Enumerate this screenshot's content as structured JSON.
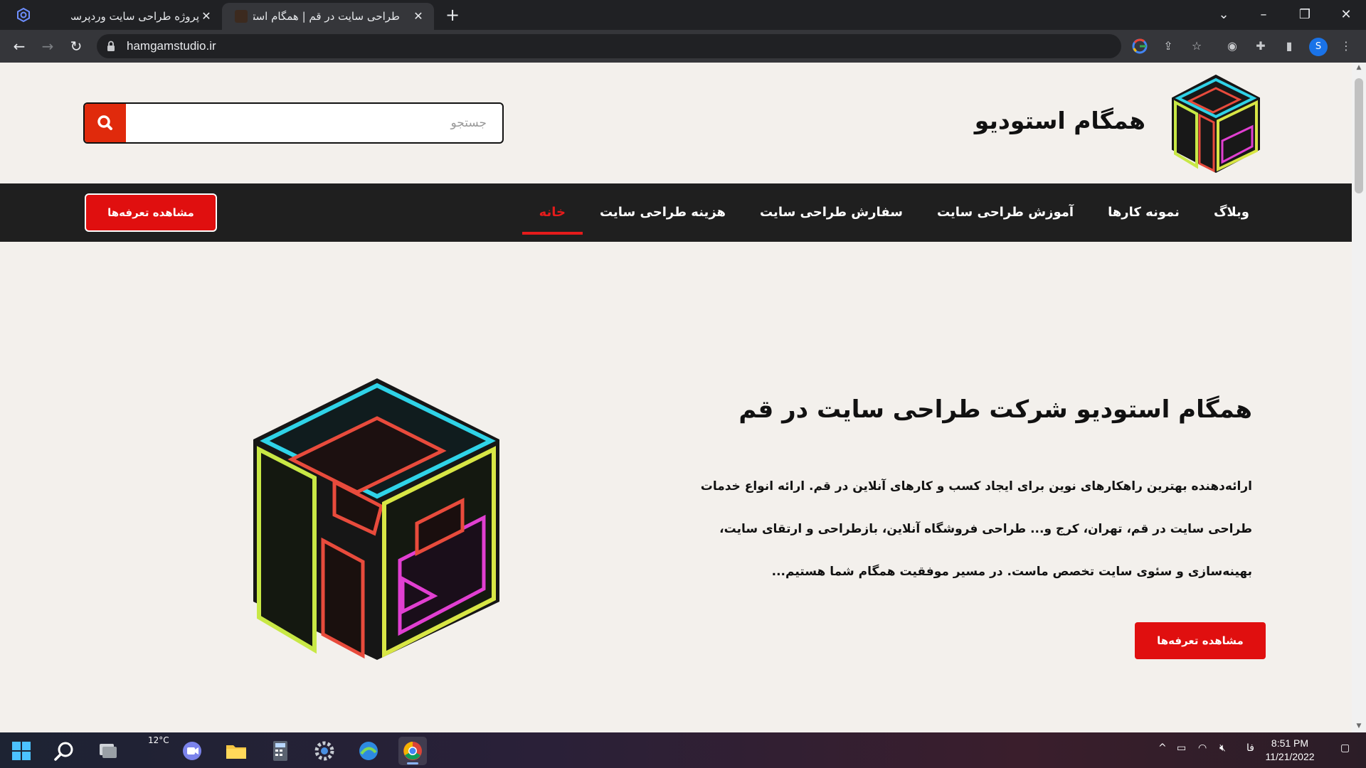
{
  "browser": {
    "tabs": [
      {
        "title": "پروژه طراحی سایت وردپرسی",
        "active": false
      },
      {
        "title": "طراحی سایت در قم | همگام استودیو",
        "active": true
      }
    ],
    "url": "hamgamstudio.ir",
    "profile_initial": "S"
  },
  "site": {
    "name": "همگام استودیو",
    "search_placeholder": "جستجو",
    "nav": [
      {
        "label": "خانه",
        "active": true
      },
      {
        "label": "هزینه طراحی سایت",
        "active": false
      },
      {
        "label": "سفارش طراحی سایت",
        "active": false
      },
      {
        "label": "آموزش طراحی سایت",
        "active": false
      },
      {
        "label": "نمونه کارها",
        "active": false
      },
      {
        "label": "وبلاگ",
        "active": false
      }
    ],
    "nav_cta": "مشاهده تعرفه‌ها",
    "accent": "#e00f0f"
  },
  "hero": {
    "title": "همگام استودیو شرکت طراحی سایت در قم",
    "text": "ارائه‌دهنده بهترین راهکارهای نوین برای ایجاد کسب و کارهای آنلاین در قم. ارائه انواع خدمات طراحی سایت در قم، تهران، کرج و... طراحی فروشگاه آنلاین، بازطراحی و ارتقای سایت، بهینه‌سازی و سئوی سایت تخصص ماست. در مسیر موفقیت همگام شما هستیم...",
    "cta": "مشاهده تعرفه‌ها"
  },
  "taskbar": {
    "weather": "12°C",
    "language": "فا",
    "time": "8:51 PM",
    "date": "11/21/2022"
  }
}
